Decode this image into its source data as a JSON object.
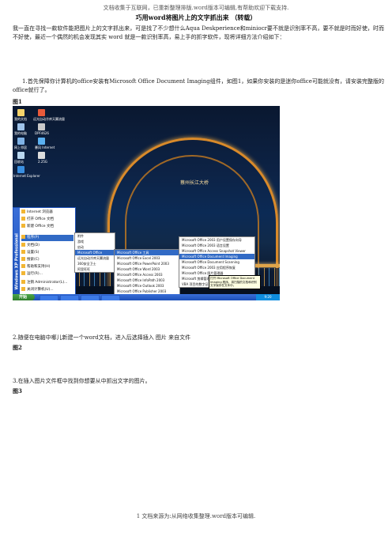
{
  "header_note": "文档收集于互联网，已重新整理排版.word版本可编辑,有帮助欢迎下载支持.",
  "title": "巧用word将图片上的文字抓出来 （转载）",
  "intro": "我一直在寻找一款软件能把图片上的文字抓出来，可是找了不少想什么Aqua Deskperience和miniocr要不就是识别率不高，要不就是时而好使，时而不好使，最近一个偶然的机会发现其实 word 就是一款识别率高，易上手的抓字软件，现将详细方法介绍如下：",
  "step1": "1.首先保障你计算机的office安装有Microsoft Office Document Imaging组件，如图1，如果你安装的是迷你office可能就没有，请安装完整版的office就行了。",
  "fig1_label": "图1",
  "step2": "2.随便在电脑中哪儿新建一个word文档，进入后选择插入 图片 来自文件",
  "fig2_label": "图2",
  "step3": "3.在插入图片文件框中找到你想要从中抓出文字的图片。",
  "fig3_label": "图3",
  "footer": "1 文档来源为:从网络收集整理.word版本可编辑.",
  "screenshot": {
    "sign_text": "蔡州长江大桥",
    "desktop_icons": [
      "我的文档",
      "我的电脑",
      "网上邻居",
      "回收站",
      "Internet Explorer",
      "远光自动冷库天翼流量",
      "DPF4626",
      "暴风 Internet",
      "2.25G"
    ],
    "start_menu_side": "Windows XP Professional",
    "start_menu_items": [
      "Internet 浏览器",
      "打开 Office 文档",
      "新建 Office 文档",
      "程序(P)",
      "文档(D)",
      "设置(S)",
      "搜索(C)",
      "帮助和支持(H)",
      "运行(R)...",
      "注销 Administrator(L)...",
      "关闭计算机(U)..."
    ],
    "start_button": "开始",
    "programs_submenu": [
      "附件",
      "游戏",
      "启动",
      "Microsoft Office",
      "远光自动冷库天翼流量",
      "360安全卫士",
      "阿里旺旺"
    ],
    "office_submenu": [
      "Microsoft Office 工具",
      "Microsoft Office Excel 2003",
      "Microsoft Office PowerPoint 2003",
      "Microsoft Office Word 2003",
      "Microsoft Office Access 2003",
      "Microsoft Office InfoPath 2003",
      "Microsoft Office Outlook 2003",
      "Microsoft Office Publisher 2003"
    ],
    "tools_submenu": [
      "Microsoft Office 2003 用户设置保存向导",
      "Microsoft Office 2003 语言设置",
      "Microsoft Office Access Snapshot Viewer",
      "Microsoft Office Document Imaging",
      "Microsoft Office Document Scanning",
      "Microsoft Office 2003 应用程序恢复",
      "Microsoft Office 图片管理器",
      "Microsoft 剪辑管理器",
      "VBA 项目的数字证书"
    ],
    "tooltip": "打开 Microsoft Office Document Imaging 程序，将扫描的文档和识别文字保存在文本中。",
    "tray_time": "9:20"
  }
}
